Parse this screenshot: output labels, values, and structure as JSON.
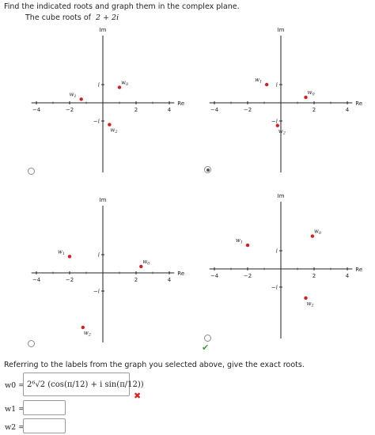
{
  "question": "Find the indicated roots and graph them in the complex plane.",
  "subquestion": {
    "label": "The cube roots of",
    "expression": "2 + 2i"
  },
  "axes": {
    "x_label": "Re",
    "y_label": "Im",
    "x_ticks": [
      "-4",
      "-2",
      "2",
      "4"
    ],
    "y_ticks": [
      "i",
      "-i"
    ]
  },
  "graphs": [
    {
      "points": [
        {
          "label": "w0",
          "re": 1.0,
          "im": 0.85
        },
        {
          "label": "w1",
          "re": -1.3,
          "im": 0.2
        },
        {
          "label": "w2",
          "re": 0.4,
          "im": -1.2
        }
      ]
    },
    {
      "points": [
        {
          "label": "w1",
          "re": -0.85,
          "im": 1.0
        },
        {
          "label": "w0",
          "re": 1.5,
          "im": 0.3
        },
        {
          "label": "w2",
          "re": -0.2,
          "im": -1.25
        }
      ]
    },
    {
      "points": [
        {
          "label": "w1",
          "re": -2.0,
          "im": 0.9
        },
        {
          "label": "w0",
          "re": 2.3,
          "im": 0.35
        },
        {
          "label": "w2",
          "re": -1.2,
          "im": -3.0
        }
      ]
    },
    {
      "points": [
        {
          "label": "w1",
          "re": -2.0,
          "im": 1.3
        },
        {
          "label": "w0",
          "re": 1.9,
          "im": 1.8
        },
        {
          "label": "w2",
          "re": 1.5,
          "im": -1.6
        }
      ]
    }
  ],
  "selected_option": 1,
  "correct_option": 3,
  "referring_text": "Referring to the labels from the graph you selected above, give the exact roots.",
  "answers": {
    "w0_label": "w0 =",
    "w0_value": "2⁶√2 (cos(π/12) + i sin(π/12))",
    "w0_status": "incorrect",
    "w1_label": "w1 =",
    "w1_value": "",
    "w2_label": "w2 =",
    "w2_value": ""
  },
  "colors": {
    "point": "#d21f1f",
    "check": "#3a9a3a",
    "cross": "#dd2222"
  }
}
